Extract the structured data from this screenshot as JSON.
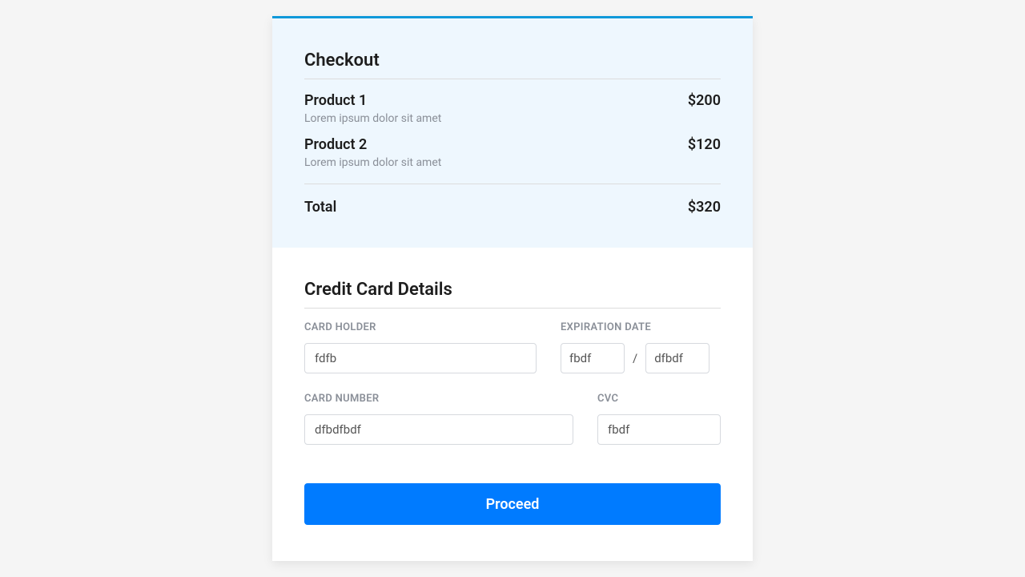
{
  "checkout": {
    "title": "Checkout",
    "items": [
      {
        "name": "Product 1",
        "desc": "Lorem ipsum dolor sit amet",
        "price": "$200"
      },
      {
        "name": "Product 2",
        "desc": "Lorem ipsum dolor sit amet",
        "price": "$120"
      }
    ],
    "total_label": "Total",
    "total_value": "$320"
  },
  "cc": {
    "title": "Credit Card Details",
    "card_holder_label": "CARD HOLDER",
    "card_holder_value": "fdfb",
    "expiration_label": "EXPIRATION DATE",
    "exp_month_value": "fbdf",
    "exp_separator": "/",
    "exp_year_value": "dfbdf",
    "card_number_label": "CARD NUMBER",
    "card_number_value": "dfbdfbdf",
    "cvc_label": "CVC",
    "cvc_value": "fbdf",
    "proceed_label": "Proceed"
  }
}
